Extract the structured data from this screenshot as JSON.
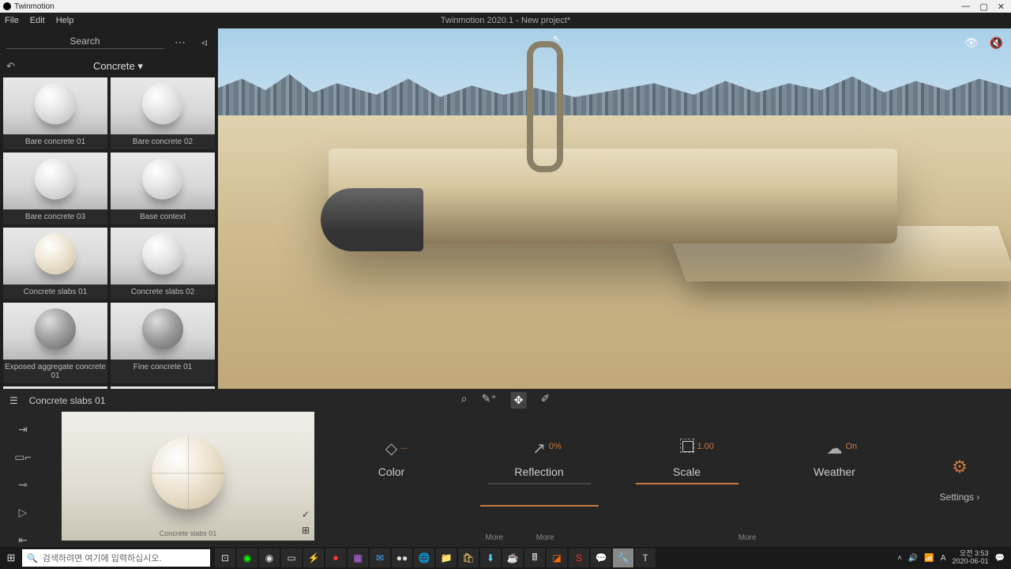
{
  "window": {
    "title": "Twinmotion",
    "buttons": {
      "min": "—",
      "max": "▢",
      "close": "✕"
    }
  },
  "menubar": {
    "items": [
      "File",
      "Edit",
      "Help"
    ],
    "doc_title": "Twinmotion 2020.1 - New project*"
  },
  "sidebar": {
    "search_label": "Search",
    "category": "Concrete",
    "materials": [
      "Bare concrete 01",
      "Bare concrete 02",
      "Bare concrete 03",
      "Base context",
      "Concrete slabs 01",
      "Concrete slabs 02",
      "Exposed aggregate concrete 01",
      "Fine concrete 01"
    ]
  },
  "dock": {
    "selected": "Concrete slabs 01",
    "preview_label": "Concrete slabs 01",
    "props": {
      "color": {
        "label": "Color",
        "value": "..."
      },
      "reflection": {
        "label": "Reflection",
        "value": "0%"
      },
      "scale": {
        "label": "Scale",
        "value": "1.00"
      },
      "weather": {
        "label": "Weather",
        "value": "On"
      }
    },
    "more": "More",
    "settings": "Settings"
  },
  "viewport_tools": [
    "match",
    "edit",
    "move",
    "pick"
  ],
  "taskbar": {
    "search_placeholder": "검색하려면 여기에 입력하십시오.",
    "time": "오전 3:53",
    "date": "2020-06-01"
  }
}
